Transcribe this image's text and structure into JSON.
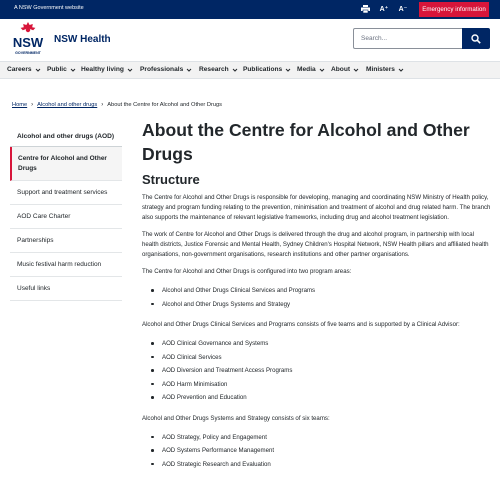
{
  "topbar": {
    "government_label": "A NSW Government website",
    "emergency_label": "Emergency information",
    "tools": [
      "printer-icon",
      "increase-text-icon",
      "decrease-text-icon"
    ],
    "increase_label": "A⁺",
    "decrease_label": "A⁻"
  },
  "header": {
    "logo_text": "NSW",
    "logo_subtext": "GOVERNMENT",
    "site_name": "NSW Health",
    "search_placeholder": "Search..."
  },
  "nav": {
    "items": [
      {
        "label": "Careers"
      },
      {
        "label": "Public"
      },
      {
        "label": "Healthy living"
      },
      {
        "label": "Professionals"
      },
      {
        "label": "Research"
      },
      {
        "label": "Publications"
      },
      {
        "label": "Media"
      },
      {
        "label": "About"
      },
      {
        "label": "Ministers"
      }
    ]
  },
  "breadcrumb": {
    "home": "Home",
    "parent": "Alcohol and other drugs",
    "current": "About the Centre for Alcohol and Other Drugs"
  },
  "sidebar": {
    "heading": "Alcohol and other drugs (AOD)",
    "items": [
      {
        "label": "Centre for Alcohol and Other Drugs",
        "active": true
      },
      {
        "label": "Support and treatment services"
      },
      {
        "label": "AOD Care Charter"
      },
      {
        "label": "Partnerships"
      },
      {
        "label": "Music festival harm reduction"
      },
      {
        "label": "Useful links"
      }
    ]
  },
  "main": {
    "title": "About the Centre for Alcohol and Other Drugs",
    "subtitle": "Structure",
    "para1": "The Centre for Alcohol and Other Drugs is responsible for developing, managing and coordinating NSW Ministry of Health policy, strategy and program funding relating to the prevention, minimisation and treatment of alcohol and drug related harm. The branch also supports the maintenance of relevant legislative frameworks, including drug and alcohol treatment legislation.",
    "para2": "The work of Centre for Alcohol and Other Drugs is delivered through the drug and alcohol program, in partnership with local health districts, Justice Forensic and Mental Health, Sydney Children's Hospital Network, NSW Health pillars and affiliated health organisations, non-government organisations, research institutions and other partner organisations.",
    "para3": "The Centre for Alcohol and Other Drugs is configured into two program areas:",
    "list1": [
      "Alcohol and Other Drugs Clinical Services and Programs",
      "Alcohol and Other Drugs Systems and Strategy"
    ],
    "para4": "Alcohol and Other Drugs Clinical Services and Programs consists of five teams and is supported by a Clinical Advisor:",
    "list2": [
      "AOD Clinical Governance and Systems",
      "AOD Clinical Services",
      "AOD Diversion and Treatment Access Programs",
      "AOD Harm Minimisation",
      "AOD Prevention and Education"
    ],
    "para5": "Alcohol and Other Drugs Systems and Strategy consists of six teams:",
    "list3": [
      "AOD Strategy, Policy and Engagement",
      "AOD Systems Performance Management",
      "AOD Strategic Research and Evaluation"
    ]
  },
  "colors": {
    "navy": "#002664",
    "red": "#d7153a"
  }
}
